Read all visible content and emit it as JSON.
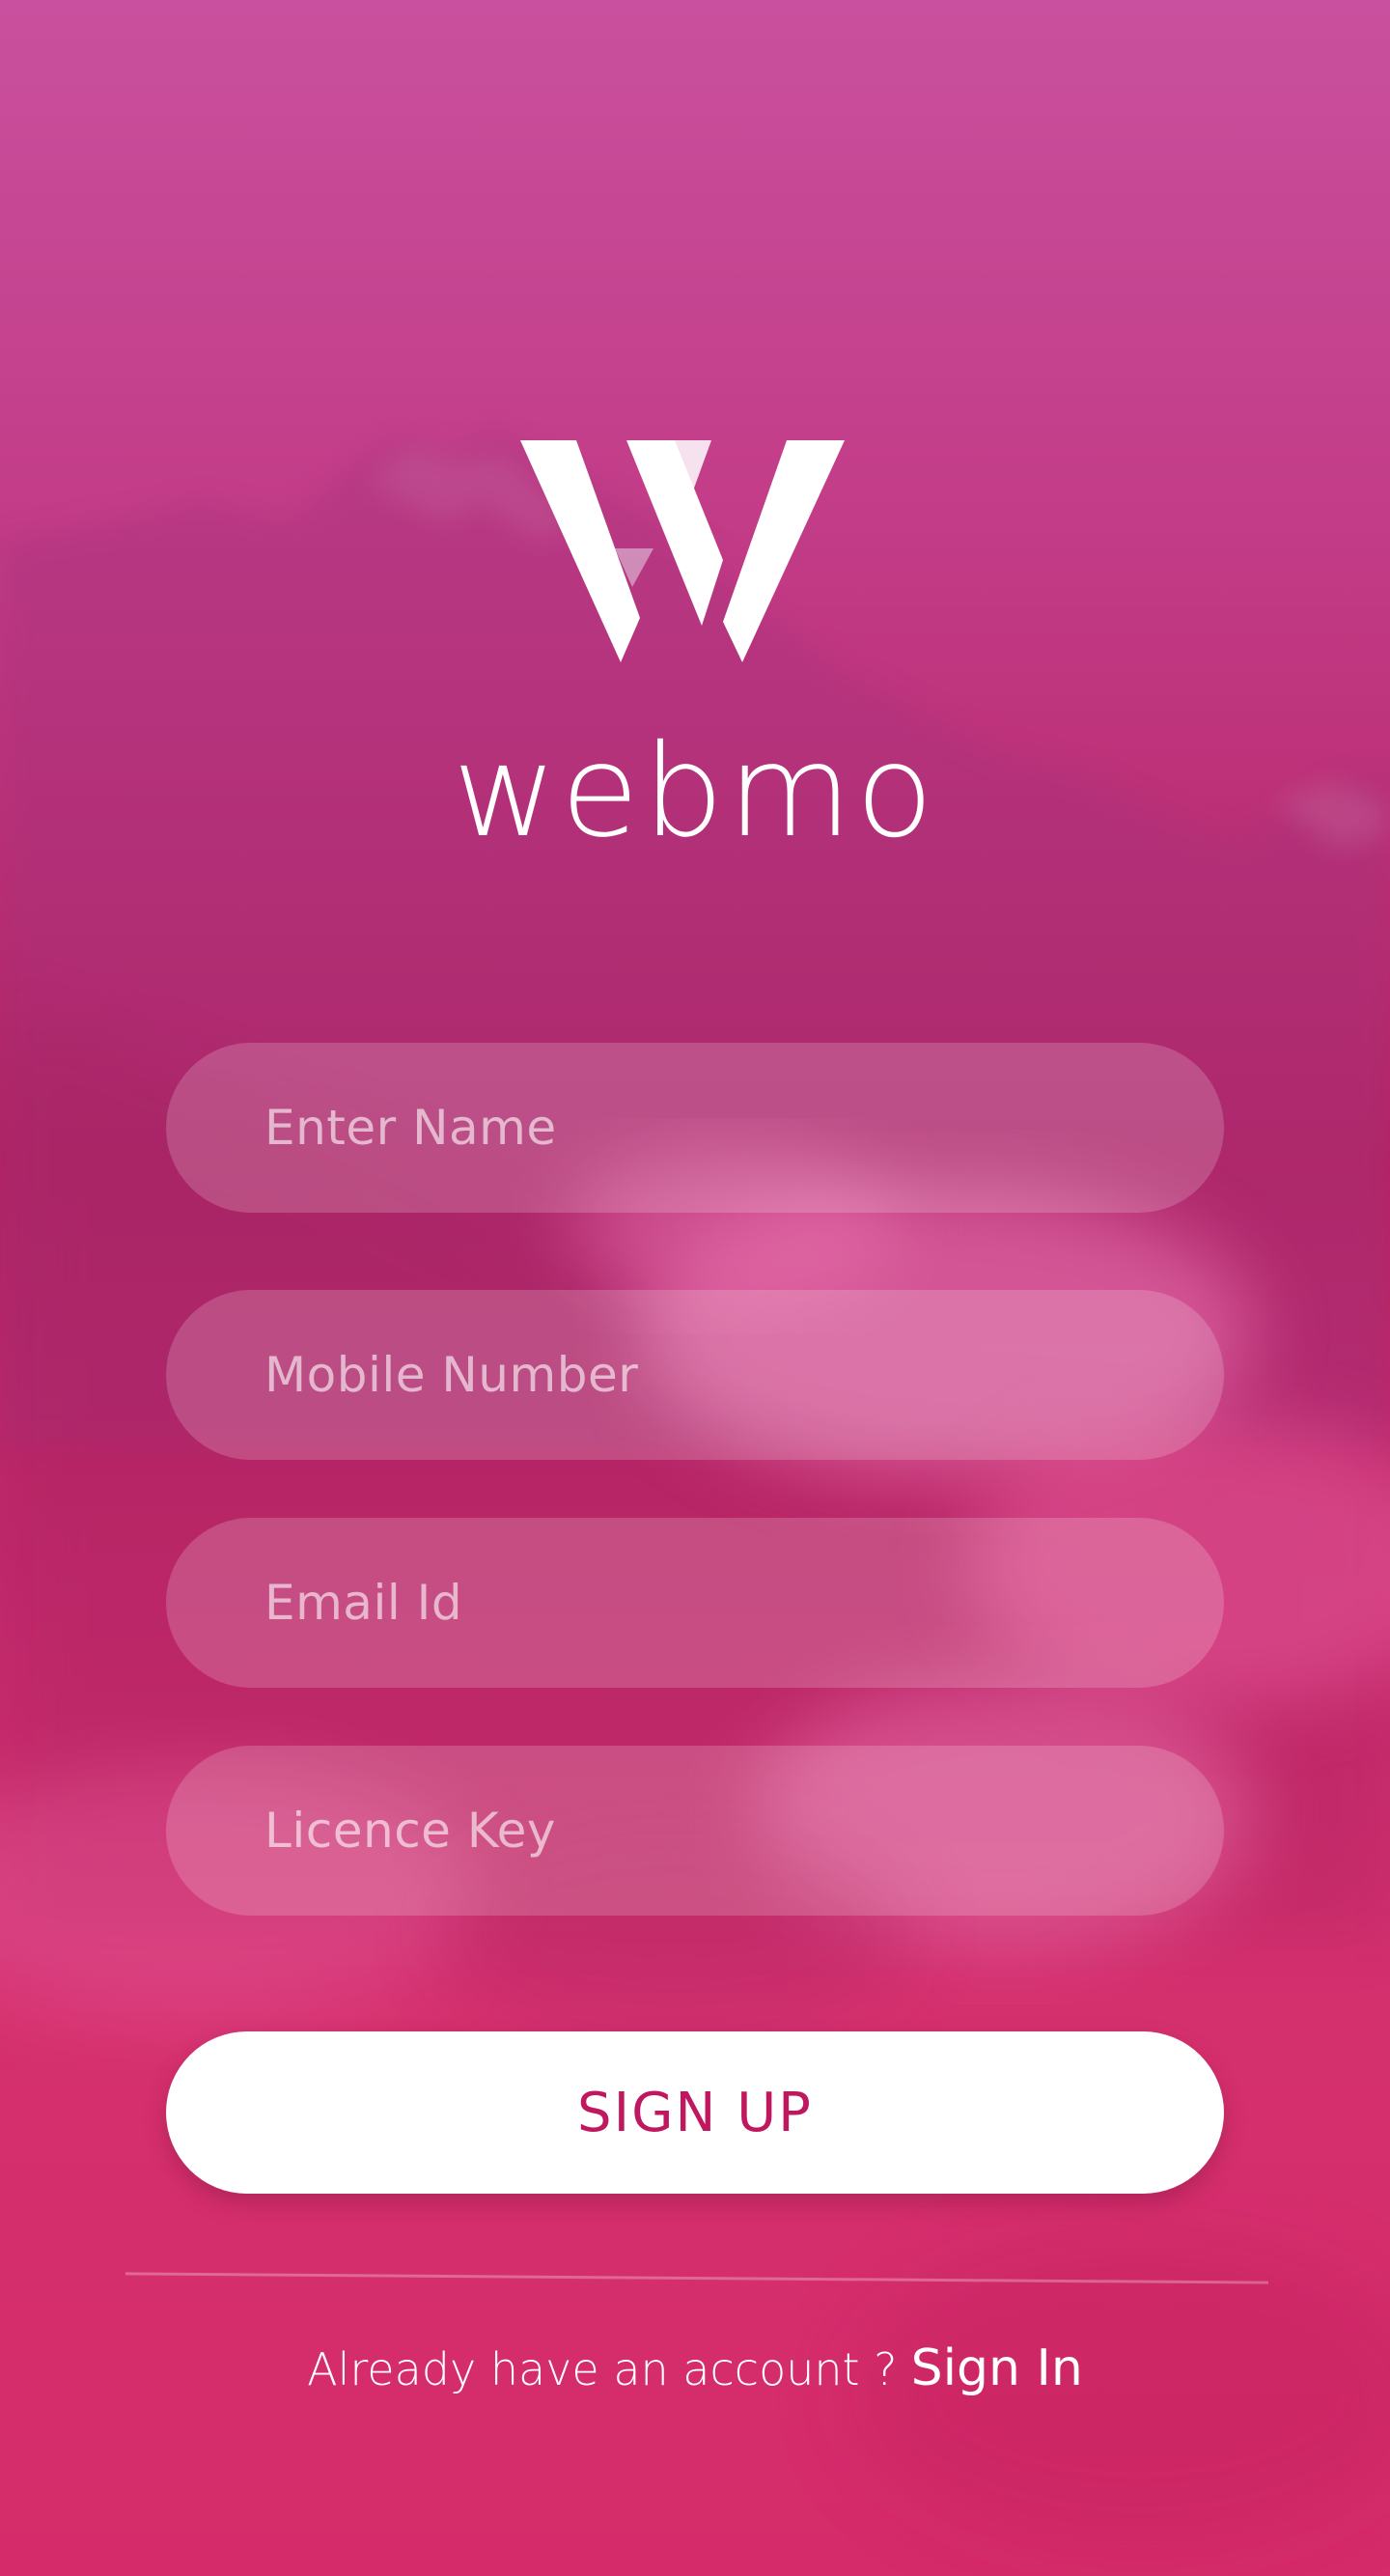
{
  "brand": {
    "name": "webmo"
  },
  "form": {
    "name_placeholder": "Enter Name",
    "mobile_placeholder": "Mobile Number",
    "email_placeholder": "Email Id",
    "licence_placeholder": "Licence Key",
    "name_value": "",
    "mobile_value": "",
    "email_value": "",
    "licence_value": ""
  },
  "actions": {
    "signup_label": "SIGN UP"
  },
  "footer": {
    "prompt": "Already have an account ?",
    "signin_label": "Sign In"
  },
  "colors": {
    "accent": "#c0185e",
    "background_top": "#c9509e",
    "background_bottom": "#d52b6a",
    "text": "#ffffff"
  },
  "icons": {
    "logo": "webmo-w-logo"
  }
}
